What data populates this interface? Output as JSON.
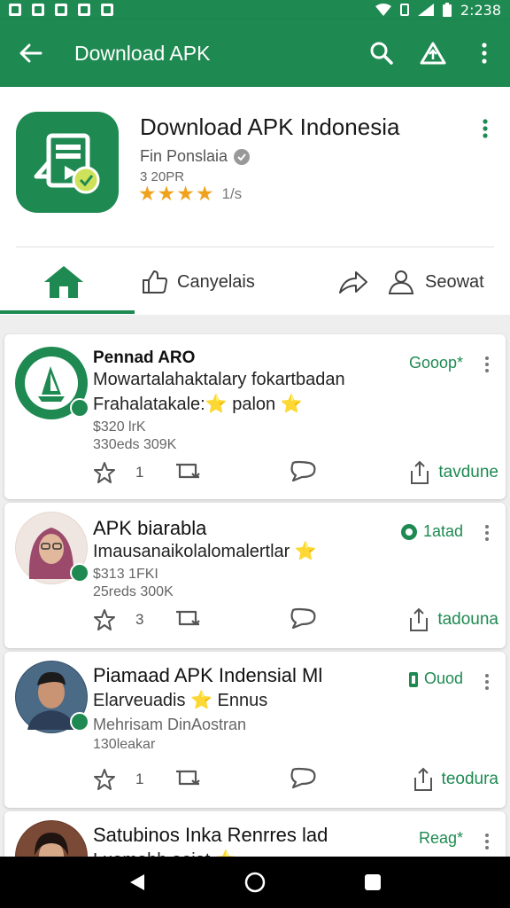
{
  "status_bar": {
    "time": "2:238"
  },
  "app_bar": {
    "title": "Download APK"
  },
  "header": {
    "app_name": "Download APK Indonesia",
    "developer": "Fin Ponslaia",
    "size": "3 20PR",
    "rating_stars": "★★★★",
    "rating_count": "1/s"
  },
  "tabs": [
    {
      "label": ""
    },
    {
      "label": "Canyelais"
    },
    {
      "label": ""
    },
    {
      "label": "Seowat"
    }
  ],
  "colors": {
    "primary": "#1e8a52",
    "star": "#f0a21c"
  },
  "posts": [
    {
      "title": "Pennad ARO",
      "line1": "Mowartalahaktalary fokartbadan",
      "line2": "Frahalatakale:⭐ palon ⭐",
      "meta1": "$320 lrK",
      "meta2": "330eds 309K",
      "badge": "Gooop*",
      "like_count": "1",
      "share_label": "tavdune"
    },
    {
      "title": "APK biarabla",
      "line1": "Imausanaikolalomalertlar ⭐",
      "meta1": "$313 1FKI",
      "meta2": "25reds 300K",
      "badge": "1atad",
      "like_count": "3",
      "share_label": "tadouna"
    },
    {
      "title": "Piamaad APK Indensial Ml",
      "line1": "Elarveuadis ⭐ Ennus",
      "meta1": "Mehrisam DinAostran",
      "meta2": "130leakar",
      "badge": "Ouod",
      "like_count": "1",
      "share_label": "teodura"
    },
    {
      "title": "Satubinos Inka Renrres lad",
      "line1": "Luamabh aoiat ⭐",
      "badge": "Reag*"
    }
  ]
}
